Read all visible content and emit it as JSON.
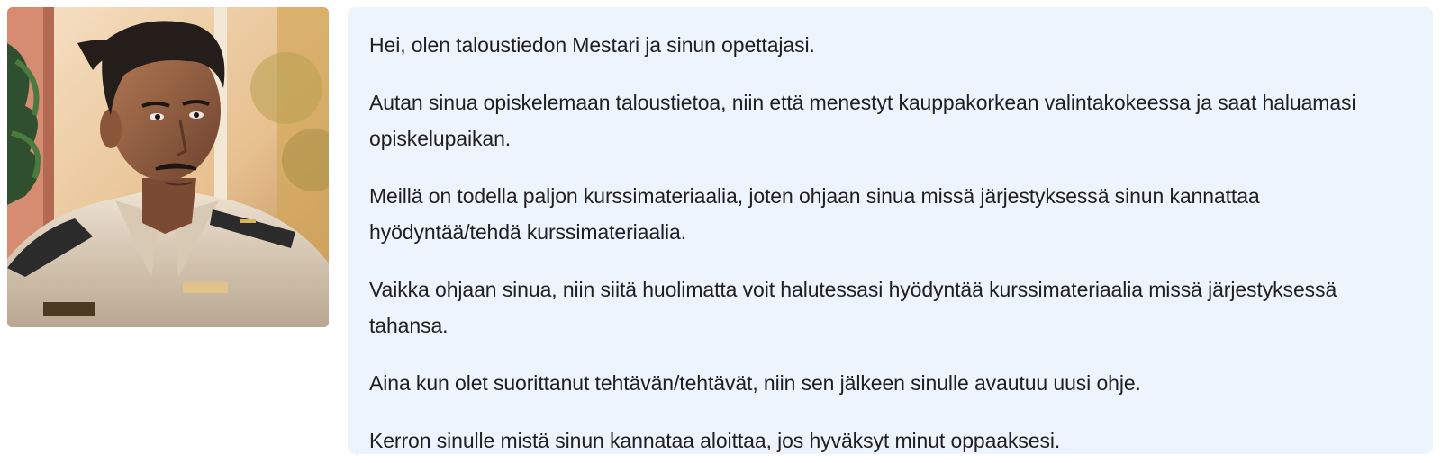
{
  "assistant": {
    "avatar_icon": "teacher-portrait-avatar",
    "bubble_color": "#eef4fe",
    "paragraphs": [
      "Hei, olen taloustiedon Mestari ja sinun opettajasi.",
      "Autan sinua opiskelemaan taloustietoa, niin että menestyt kauppakorkean valintakokeessa ja saat haluamasi opiskelupaikan.",
      "Meillä on todella paljon kurssimateriaalia, joten ohjaan sinua missä järjestyksessä sinun kannattaa hyödyntää/tehdä kurssimateriaalia.",
      "Vaikka ohjaan sinua, niin siitä huolimatta voit halutessasi hyödyntää kurssimateriaalia missä järjestyksessä tahansa.",
      "Aina kun olet suorittanut tehtävän/tehtävät, niin sen jälkeen sinulle avautuu uusi ohje.",
      "Kerron sinulle mistä sinun kannataa aloittaa, jos hyväksyt minut oppaaksesi."
    ]
  }
}
